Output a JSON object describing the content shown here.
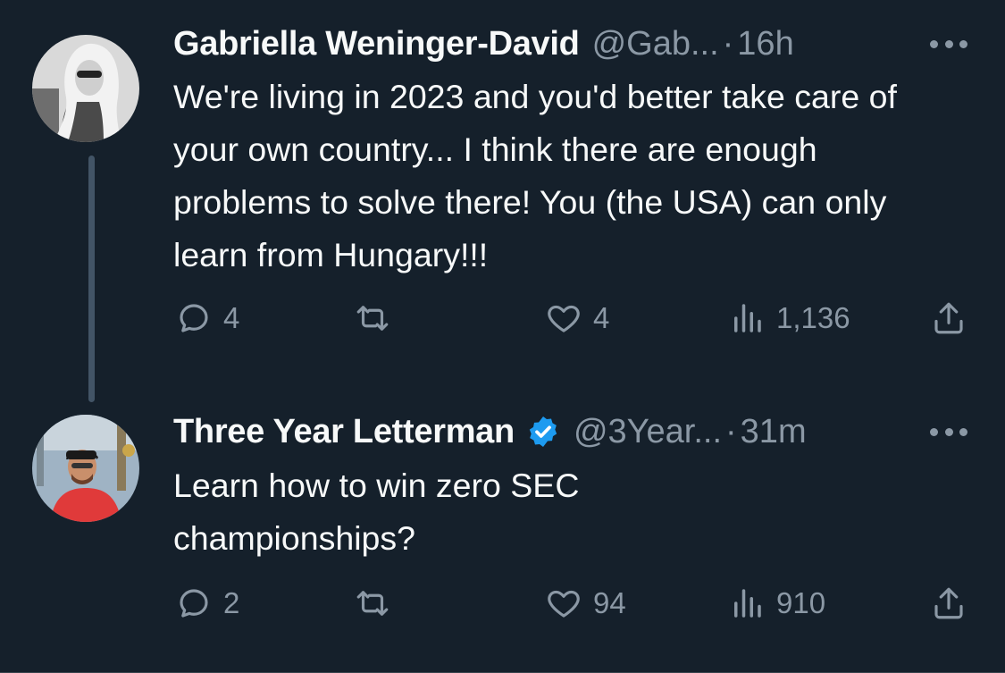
{
  "tweets": [
    {
      "author": "Gabriella Weninger-David",
      "handle": "@Gab...",
      "separator": "·",
      "time": "16h",
      "text": "We're living in 2023 and you'd better take care of your own country... I think there are enough problems to solve there! You (the USA) can only learn from Hungary!!!",
      "replies": "4",
      "retweets": "",
      "likes": "4",
      "views": "1,136",
      "verified": false
    },
    {
      "author": "Three Year Letterman",
      "handle": "@3Year...",
      "separator": "·",
      "time": "31m",
      "text": "Learn how to win zero SEC championships?",
      "replies": "2",
      "retweets": "",
      "likes": "94",
      "views": "910",
      "verified": true
    }
  ],
  "colors": {
    "background": "#15202b",
    "text": "#f7f9f9",
    "secondary": "#8b98a5",
    "verified_badge": "#1d9bf0",
    "thread_line": "#425466"
  },
  "icons": [
    "reply-icon",
    "retweet-icon",
    "like-icon",
    "views-icon",
    "share-icon",
    "more-icon",
    "verified-badge-icon"
  ]
}
